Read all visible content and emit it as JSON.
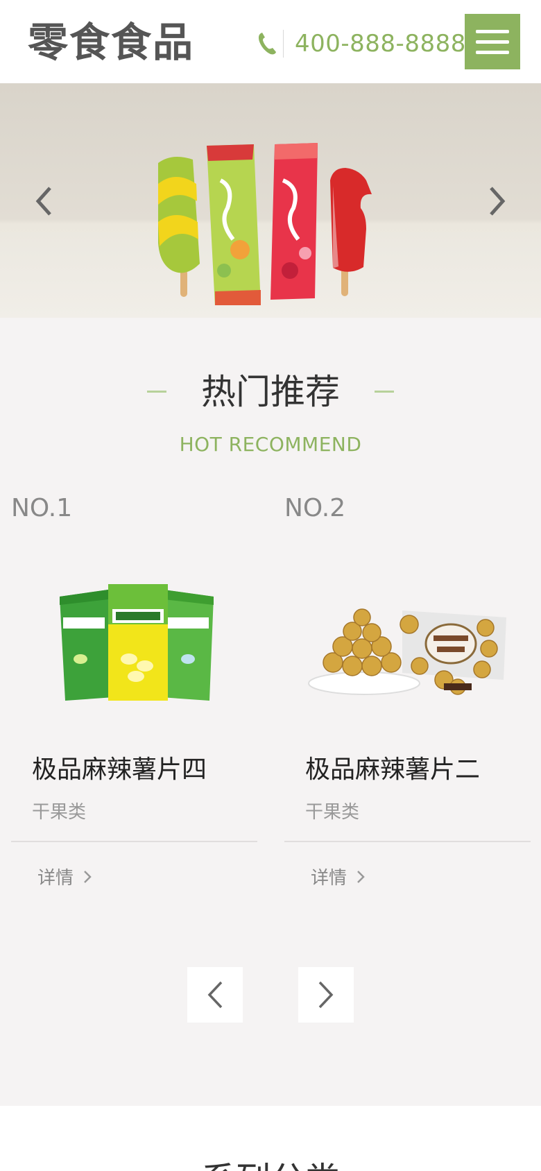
{
  "header": {
    "logo_text": "零食食品",
    "phone_icon": "phone-icon",
    "phone_number": "400-888-8888",
    "menu_icon": "hamburger-menu-icon"
  },
  "banner": {
    "prev_icon": "chevron-left-icon",
    "next_icon": "chevron-right-icon"
  },
  "hot": {
    "title": "热门推荐",
    "subtitle": "HOT RECOMMEND",
    "products": [
      {
        "rank": "NO.1",
        "name": "极品麻辣薯片四",
        "category": "干果类",
        "detail_label": "详情"
      },
      {
        "rank": "NO.2",
        "name": "极品麻辣薯片二",
        "category": "干果类",
        "detail_label": "详情"
      }
    ],
    "pager_prev_icon": "chevron-left-icon",
    "pager_next_icon": "chevron-right-icon"
  },
  "next_section": {
    "title": "系列分类"
  },
  "colors": {
    "accent": "#8db35f",
    "background": "#f5f3f3",
    "text_dark": "#333333",
    "text_muted": "#999999"
  }
}
